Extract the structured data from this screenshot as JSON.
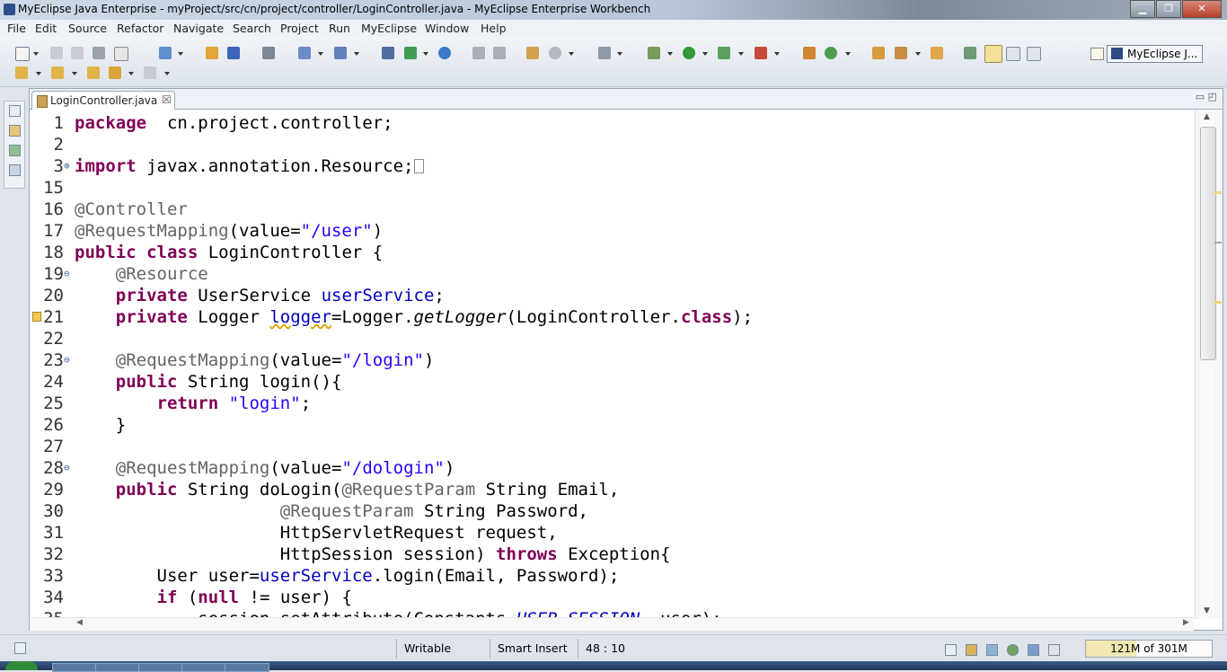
{
  "window": {
    "title": "MyEclipse Java Enterprise - myProject/src/cn/project/controller/LoginController.java - MyEclipse Enterprise Workbench",
    "minimize": "▁",
    "maximize": "❐",
    "close": "✕"
  },
  "menu": [
    "File",
    "Edit",
    "Source",
    "Refactor",
    "Navigate",
    "Search",
    "Project",
    "Run",
    "MyEclipse",
    "Window",
    "Help"
  ],
  "perspective": {
    "label": "MyEclipse J..."
  },
  "editor": {
    "tab_label": "LoginController.java",
    "tab_close": "☒",
    "minmax": "▭ ◰",
    "lines": [
      {
        "n": "1",
        "fold": "",
        "warn": false,
        "parts": [
          [
            "kw",
            "package"
          ],
          [
            "",
            "  cn.project.controller;"
          ]
        ]
      },
      {
        "n": "2",
        "fold": "",
        "warn": false,
        "parts": []
      },
      {
        "n": "3",
        "fold": "⊕",
        "warn": false,
        "parts": [
          [
            "kw",
            "import"
          ],
          [
            "",
            " javax.annotation.Resource;"
          ],
          [
            "box",
            ""
          ]
        ]
      },
      {
        "n": "15",
        "fold": "",
        "warn": false,
        "parts": []
      },
      {
        "n": "16",
        "fold": "",
        "warn": false,
        "parts": [
          [
            "ann",
            "@Controller"
          ]
        ]
      },
      {
        "n": "17",
        "fold": "",
        "warn": false,
        "parts": [
          [
            "ann",
            "@RequestMapping"
          ],
          [
            "",
            "(value="
          ],
          [
            "str",
            "\"/user\""
          ],
          [
            "",
            ")"
          ]
        ]
      },
      {
        "n": "18",
        "fold": "",
        "warn": false,
        "parts": [
          [
            "kw",
            "public"
          ],
          [
            "",
            " "
          ],
          [
            "kw",
            "class"
          ],
          [
            "",
            " LoginController {"
          ]
        ]
      },
      {
        "n": "19",
        "fold": "⊖",
        "warn": false,
        "parts": [
          [
            "",
            "    "
          ],
          [
            "ann",
            "@Resource"
          ]
        ]
      },
      {
        "n": "20",
        "fold": "",
        "warn": false,
        "parts": [
          [
            "",
            "    "
          ],
          [
            "kw",
            "private"
          ],
          [
            "",
            " UserService "
          ],
          [
            "fld",
            "userService"
          ],
          [
            "",
            ";"
          ]
        ]
      },
      {
        "n": "21",
        "fold": "",
        "warn": true,
        "parts": [
          [
            "",
            "    "
          ],
          [
            "kw",
            "private"
          ],
          [
            "",
            " Logger "
          ],
          [
            "fldwarn",
            "logger"
          ],
          [
            "",
            "=Logger."
          ],
          [
            "it",
            "getLogger"
          ],
          [
            "",
            "(LoginController."
          ],
          [
            "kw",
            "class"
          ],
          [
            "",
            ");"
          ]
        ]
      },
      {
        "n": "22",
        "fold": "",
        "warn": false,
        "parts": []
      },
      {
        "n": "23",
        "fold": "⊖",
        "warn": false,
        "parts": [
          [
            "",
            "    "
          ],
          [
            "ann",
            "@RequestMapping"
          ],
          [
            "",
            "(value="
          ],
          [
            "str",
            "\"/login\""
          ],
          [
            "",
            ")"
          ]
        ]
      },
      {
        "n": "24",
        "fold": "",
        "warn": false,
        "parts": [
          [
            "",
            "    "
          ],
          [
            "kw",
            "public"
          ],
          [
            "",
            " String login(){"
          ]
        ]
      },
      {
        "n": "25",
        "fold": "",
        "warn": false,
        "parts": [
          [
            "",
            "        "
          ],
          [
            "kw",
            "return"
          ],
          [
            "",
            " "
          ],
          [
            "str",
            "\"login\""
          ],
          [
            "",
            ";"
          ]
        ]
      },
      {
        "n": "26",
        "fold": "",
        "warn": false,
        "parts": [
          [
            "",
            "    }"
          ]
        ]
      },
      {
        "n": "27",
        "fold": "",
        "warn": false,
        "parts": []
      },
      {
        "n": "28",
        "fold": "⊖",
        "warn": false,
        "parts": [
          [
            "",
            "    "
          ],
          [
            "ann",
            "@RequestMapping"
          ],
          [
            "",
            "(value="
          ],
          [
            "str",
            "\"/dologin\""
          ],
          [
            "",
            ")"
          ]
        ]
      },
      {
        "n": "29",
        "fold": "",
        "warn": false,
        "parts": [
          [
            "",
            "    "
          ],
          [
            "kw",
            "public"
          ],
          [
            "",
            " String doLogin("
          ],
          [
            "ann",
            "@RequestParam"
          ],
          [
            "",
            " String Email,"
          ]
        ]
      },
      {
        "n": "30",
        "fold": "",
        "warn": false,
        "parts": [
          [
            "",
            "                    "
          ],
          [
            "ann",
            "@RequestParam"
          ],
          [
            "",
            " String Password,"
          ]
        ]
      },
      {
        "n": "31",
        "fold": "",
        "warn": false,
        "parts": [
          [
            "",
            "                    HttpServletRequest request,"
          ]
        ]
      },
      {
        "n": "32",
        "fold": "",
        "warn": false,
        "parts": [
          [
            "",
            "                    HttpSession session) "
          ],
          [
            "kw",
            "throws"
          ],
          [
            "",
            " Exception{"
          ]
        ]
      },
      {
        "n": "33",
        "fold": "",
        "warn": false,
        "parts": [
          [
            "",
            "        User user="
          ],
          [
            "fld",
            "userService"
          ],
          [
            "",
            ".login(Email, Password);"
          ]
        ]
      },
      {
        "n": "34",
        "fold": "",
        "warn": false,
        "parts": [
          [
            "",
            "        "
          ],
          [
            "kw",
            "if"
          ],
          [
            "",
            " ("
          ],
          [
            "kw",
            "null"
          ],
          [
            "",
            " != user) {"
          ]
        ]
      },
      {
        "n": "35",
        "fold": "",
        "warn": false,
        "parts": [
          [
            "",
            "            session.setAttribute(Constants."
          ],
          [
            "cst",
            "USER_SESSION"
          ],
          [
            "",
            ", user);"
          ]
        ]
      }
    ]
  },
  "status": {
    "writable": "Writable",
    "insert_mode": "Smart Insert",
    "position": "48 : 10",
    "heap": "121M of 301M"
  }
}
